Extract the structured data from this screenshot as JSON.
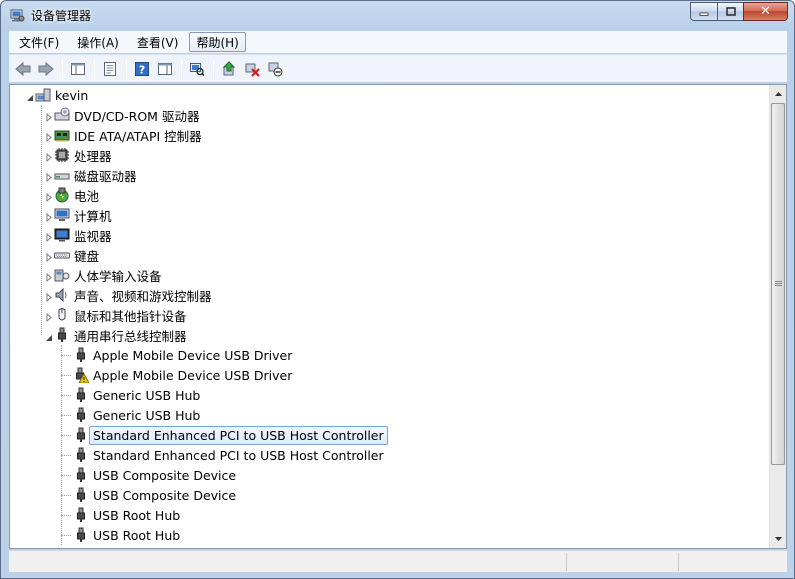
{
  "window": {
    "title": "设备管理器"
  },
  "menu": [
    {
      "label": "文件(F)"
    },
    {
      "label": "操作(A)"
    },
    {
      "label": "查看(V)"
    },
    {
      "label": "帮助(H)",
      "active": true
    }
  ],
  "toolbar": {
    "buttons": [
      "back-icon",
      "forward-icon",
      "show-hide-console-tree-icon",
      "properties-icon",
      "help-icon",
      "show-hide-action-pane-icon",
      "scan-hardware-icon",
      "update-driver-icon",
      "uninstall-icon",
      "disable-icon"
    ]
  },
  "tree": {
    "root": {
      "label": "kevin",
      "icon": "computer-icon",
      "expanded": true
    },
    "categories": [
      {
        "label": "DVD/CD-ROM 驱动器",
        "icon": "dvd-drive-icon"
      },
      {
        "label": "IDE ATA/ATAPI 控制器",
        "icon": "ide-controller-icon"
      },
      {
        "label": "处理器",
        "icon": "processor-icon"
      },
      {
        "label": "磁盘驱动器",
        "icon": "disk-drive-icon"
      },
      {
        "label": "电池",
        "icon": "battery-icon"
      },
      {
        "label": "计算机",
        "icon": "computer-monitor-icon"
      },
      {
        "label": "监视器",
        "icon": "monitor-icon"
      },
      {
        "label": "键盘",
        "icon": "keyboard-icon"
      },
      {
        "label": "人体学输入设备",
        "icon": "hid-icon"
      },
      {
        "label": "声音、视频和游戏控制器",
        "icon": "speaker-icon"
      },
      {
        "label": "鼠标和其他指针设备",
        "icon": "mouse-icon"
      },
      {
        "label": "通用串行总线控制器",
        "icon": "usb-icon",
        "expanded": true
      }
    ],
    "usb_children": [
      {
        "label": "Apple Mobile Device USB Driver",
        "icon": "usb-icon"
      },
      {
        "label": "Apple Mobile Device USB Driver",
        "icon": "usb-warning-icon"
      },
      {
        "label": "Generic USB Hub",
        "icon": "usb-icon"
      },
      {
        "label": "Generic USB Hub",
        "icon": "usb-icon"
      },
      {
        "label": "Standard Enhanced PCI to USB Host Controller",
        "icon": "usb-icon",
        "selected": true
      },
      {
        "label": "Standard Enhanced PCI to USB Host Controller",
        "icon": "usb-icon"
      },
      {
        "label": "USB Composite Device",
        "icon": "usb-icon"
      },
      {
        "label": "USB Composite Device",
        "icon": "usb-icon"
      },
      {
        "label": "USB Root Hub",
        "icon": "usb-icon"
      },
      {
        "label": "USB Root Hub",
        "icon": "usb-icon"
      }
    ]
  },
  "colors": {
    "selection": "#dcebfc",
    "selection_border": "#7da2ce",
    "title_gradient": "#b9d0ea"
  }
}
